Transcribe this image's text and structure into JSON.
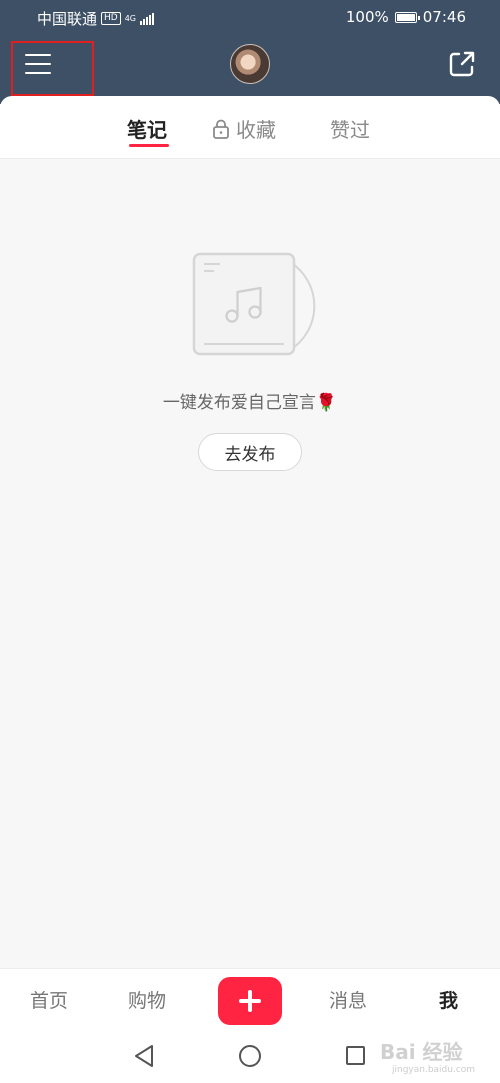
{
  "status_bar": {
    "carrier": "中国联通",
    "hd": "HD",
    "network": "4G",
    "battery_percent": "100%",
    "battery_level": 1.0,
    "time": "07:46"
  },
  "header": {
    "avatar": "avatar-photo",
    "menu_icon": "hamburger-menu-icon",
    "share_icon": "share-external-icon"
  },
  "tabs": [
    {
      "label": "笔记",
      "active": true
    },
    {
      "label": "收藏",
      "locked": true
    },
    {
      "label": "赞过"
    }
  ],
  "empty_state": {
    "message": "一键发布爱自己宣言",
    "emoji": "🌹",
    "button": "去发布"
  },
  "bottom_nav": {
    "items": [
      "首页",
      "购物",
      "消息",
      "我"
    ],
    "active": "我"
  },
  "watermark": {
    "text": "Bai 经验",
    "sub": "jingyan.baidu.com"
  },
  "colors": {
    "header_bg": "#3d5066",
    "accent": "#ff2442"
  }
}
